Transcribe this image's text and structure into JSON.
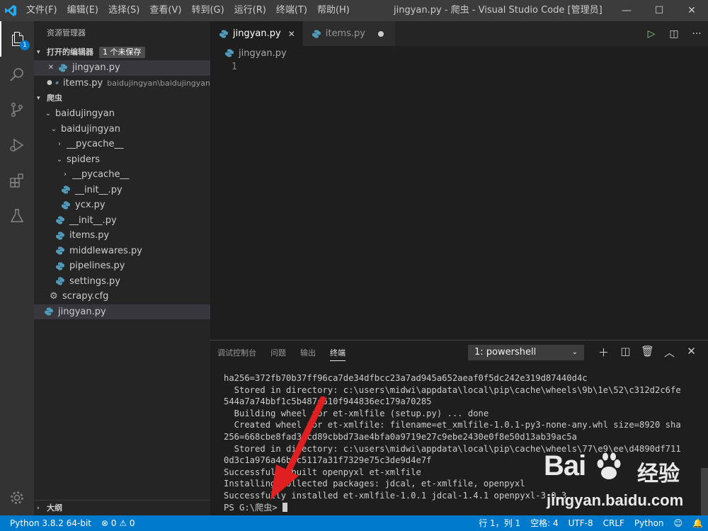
{
  "titlebar": {
    "menu": [
      "文件(F)",
      "编辑(E)",
      "选择(S)",
      "查看(V)",
      "转到(G)",
      "运行(R)",
      "终端(T)",
      "帮助(H)"
    ],
    "window_title": "jingyan.py - 爬虫 - Visual Studio Code [管理员]",
    "minimize_glyph": "—",
    "maximize_glyph": "☐",
    "close_glyph": "✕"
  },
  "activity": {
    "explorer_badge": "1",
    "items": [
      "files-icon",
      "search-icon",
      "source-control-icon",
      "run-debug-icon",
      "extensions-icon",
      "testing-icon",
      "settings-gear-icon"
    ]
  },
  "sidebar": {
    "title": "资源管理器",
    "open_editors": {
      "label": "打开的编辑器",
      "unsaved_badge": "1 个未保存",
      "items": [
        {
          "name": "jingyan.py",
          "desc": "",
          "marker": "✕"
        },
        {
          "name": "items.py",
          "desc": "baidujingyan\\baidujingyan",
          "marker": "●"
        }
      ]
    },
    "folder": {
      "label": "爬虫",
      "tree": [
        {
          "name": "baidujingyan",
          "twisty": "⌄"
        },
        {
          "name": "baidujingyan",
          "twisty": "⌄"
        },
        {
          "name": "__pycache__",
          "twisty": "›"
        },
        {
          "name": "spiders",
          "twisty": "⌄"
        },
        {
          "name": "__pycache__",
          "twisty": "›"
        },
        {
          "name": "__init__.py"
        },
        {
          "name": "ycx.py"
        },
        {
          "name": "__init__.py"
        },
        {
          "name": "items.py"
        },
        {
          "name": "middlewares.py"
        },
        {
          "name": "pipelines.py"
        },
        {
          "name": "settings.py"
        },
        {
          "name": "scrapy.cfg"
        },
        {
          "name": "jingyan.py"
        }
      ]
    },
    "outline_label": "大纲"
  },
  "editor": {
    "tabs": [
      {
        "label": "jingyan.py",
        "active": true
      },
      {
        "label": "items.py",
        "active": false
      }
    ],
    "breadcrumb": "jingyan.py",
    "line_number": "1"
  },
  "panel": {
    "tabs": [
      "调试控制台",
      "问题",
      "输出",
      "终端"
    ],
    "active_tab": "终端",
    "terminal_select": "1: powershell",
    "lines": [
      "ha256=372fb70b37ff96ca7de34dfbcc23a7ad945a652aeaf0f5dc242e319d87440d4c",
      "  Stored in directory: c:\\users\\midwi\\appdata\\local\\pip\\cache\\wheels\\9b\\1e\\52\\c312d2c6fe",
      "544a7a74bbf1c5b487c610f944836ec179a70285",
      "  Building wheel for et-xmlfile (setup.py) ... done",
      "  Created wheel for et-xmlfile: filename=et_xmlfile-1.0.1-py3-none-any.whl size=8920 sha",
      "256=668cbe8fad31cd89cbbd73ae4bfa0a9719e27c9ebe2430e0f8e50d13ab39ac5a",
      "  Stored in directory: c:\\users\\midwi\\appdata\\local\\pip\\cache\\wheels\\77\\e9\\ee\\d4890df711",
      "0d3c1a976a46bbc5117a31f7329e75c3de9d4e7f",
      "Successfully built openpyxl et-xmlfile",
      "Installing collected packages: jdcal, et-xmlfile, openpyxl",
      "Successfully installed et-xmlfile-1.0.1 jdcal-1.4.1 openpyxl-3.0.3"
    ],
    "prompt": "PS G:\\爬虫> "
  },
  "statusbar": {
    "python": "Python 3.8.2 64-bit",
    "problems": "⊗ 0 ⚠ 0",
    "position": "行 1，列 1",
    "spaces": "空格: 4",
    "encoding": "UTF-8",
    "eol": "CRLF",
    "language": "Python"
  },
  "watermark": {
    "brand": "Bai",
    "brand_cn": "经验",
    "url": "jingyan.baidu.com"
  },
  "colors": {
    "accent": "#007acc",
    "annotation_arrow": "#e02020",
    "python_icon": "#519aba"
  }
}
